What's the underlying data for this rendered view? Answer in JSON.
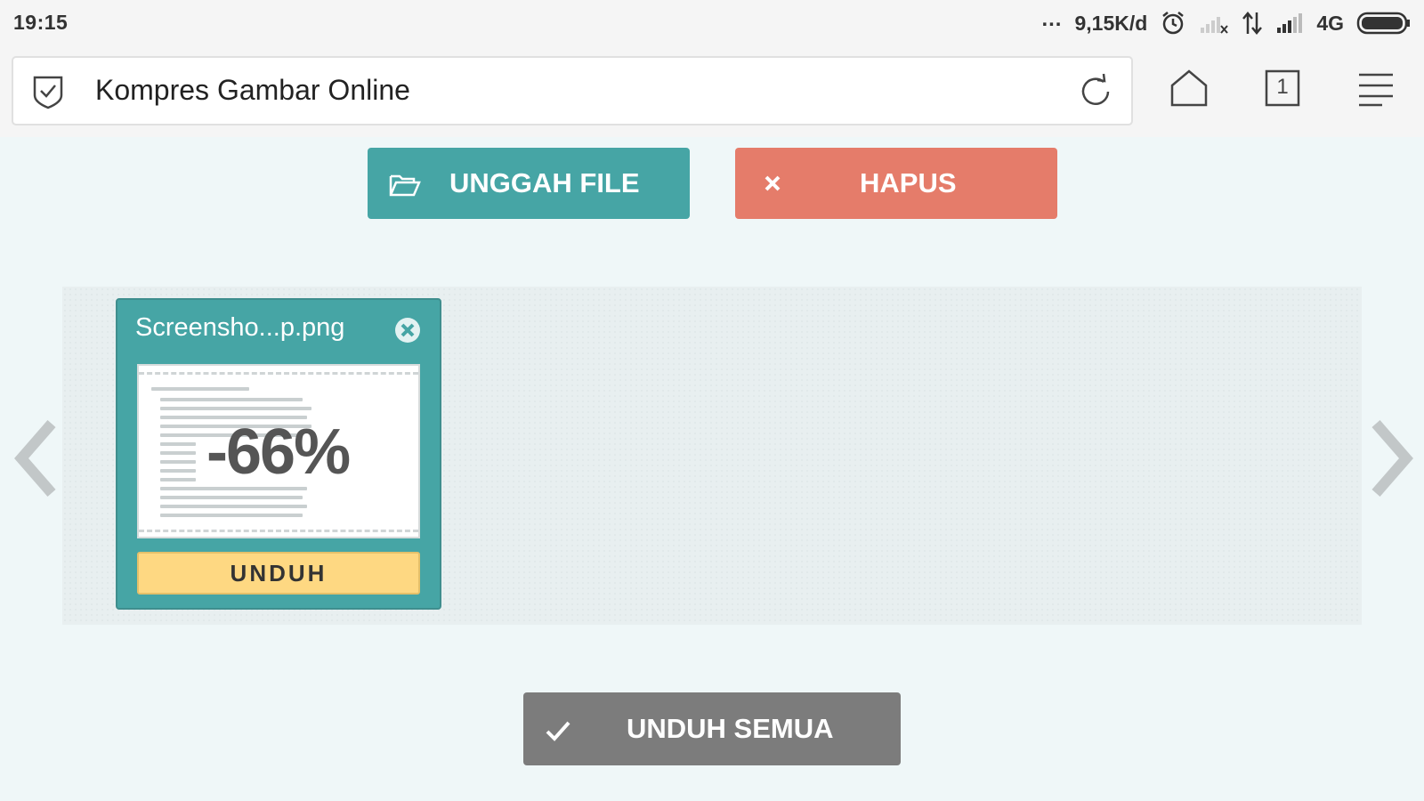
{
  "status_bar": {
    "time": "19:15",
    "dots": "...",
    "speed": "9,15K/d",
    "network": "4G",
    "icons": [
      "alarm-icon",
      "signal-none-icon",
      "data-arrows-icon",
      "signal-icon",
      "battery-icon"
    ]
  },
  "browser": {
    "page_title": "Kompres Gambar Online",
    "tab_count": "1",
    "icons": [
      "shield-check-icon",
      "reload-icon",
      "home-icon",
      "tabs-icon",
      "menu-icon"
    ]
  },
  "actions": {
    "upload_label": "UNGGAH FILE",
    "delete_label": "HAPUS",
    "download_all_label": "UNDUH SEMUA"
  },
  "files": [
    {
      "name": "Screensho...p.png",
      "ratio": "-66%",
      "download_label": "UNDUH"
    }
  ],
  "colors": {
    "teal": "#46a5a5",
    "coral": "#e57c6a",
    "yellow": "#fed882",
    "gray": "#7c7c7c",
    "page_bg": "#eff7f8"
  }
}
